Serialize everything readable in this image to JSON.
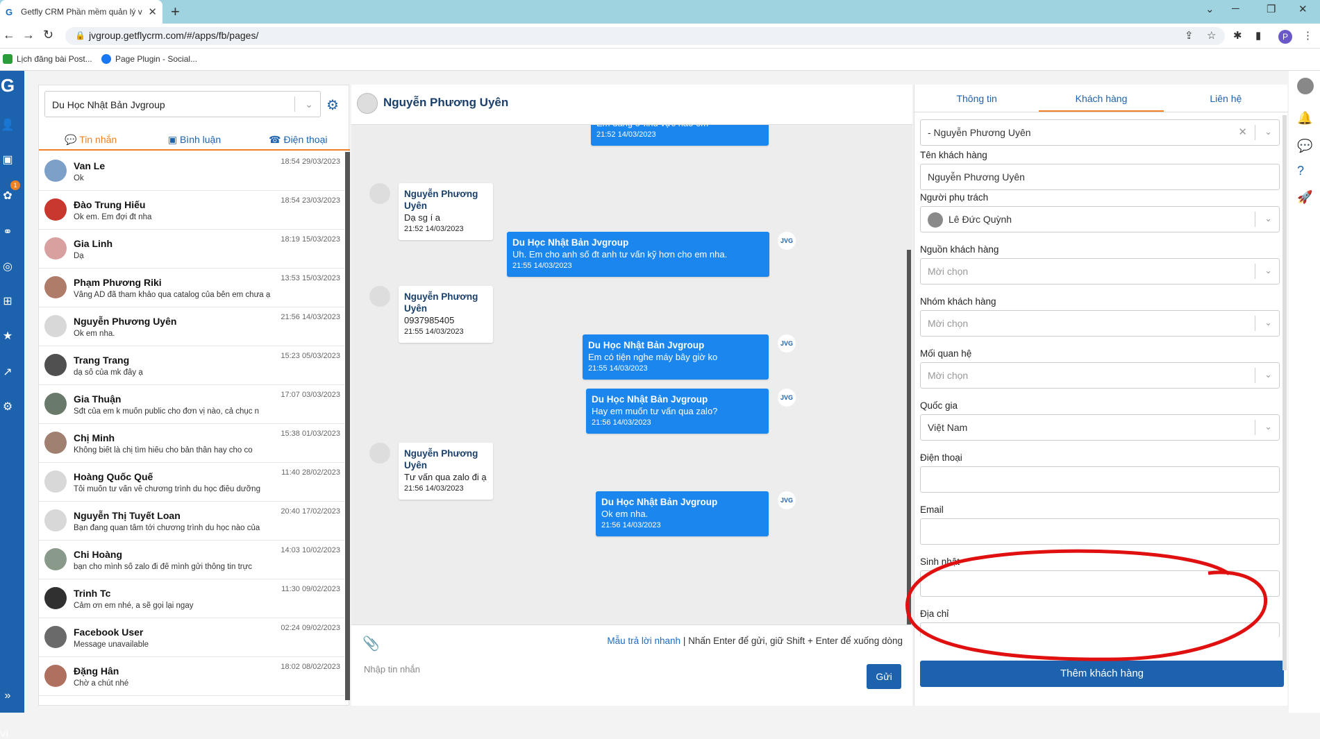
{
  "browser": {
    "tab_title": "Getfly CRM Phần mềm quản lý v",
    "url": "jvgroup.getflycrm.com/#/apps/fb/pages/",
    "bookmarks": [
      "Lịch đăng bài Post...",
      "Page Plugin - Social..."
    ],
    "profile_initial": "P"
  },
  "leftnav": {
    "badge": "1",
    "lang": "VI"
  },
  "page_select": {
    "value": "Du Học Nhật Bản Jvgroup"
  },
  "conv_tabs": [
    "Tin nhắn",
    "Bình luận",
    "Điện thoại"
  ],
  "conversations": [
    {
      "name": "Van Le",
      "preview": "Ok",
      "time": "18:54 29/03/2023"
    },
    {
      "name": "Đào Trung Hiếu",
      "preview": "Ok em. Em đợi đt nha",
      "time": "18:54 23/03/2023"
    },
    {
      "name": "Gia Linh",
      "preview": "Dạ",
      "time": "18:19 15/03/2023"
    },
    {
      "name": "Phạm Phương Riki",
      "preview": "Vâng AD đã tham khảo qua catalog của bên em chưa ạ",
      "time": "13:53 15/03/2023"
    },
    {
      "name": "Nguyễn Phương Uyên",
      "preview": "Ok em nha.",
      "time": "21:56 14/03/2023"
    },
    {
      "name": "Trang Trang",
      "preview": "dạ số của mk đây ạ",
      "time": "15:23 05/03/2023"
    },
    {
      "name": "Gia Thuận",
      "preview": "Sđt của em k muốn public cho đơn vị nào, cả chục n",
      "time": "17:07 03/03/2023"
    },
    {
      "name": "Chị Minh",
      "preview": "Không biết là chị tìm hiểu cho bản thân hay cho co",
      "time": "15:38 01/03/2023"
    },
    {
      "name": "Hoàng Quốc Quế",
      "preview": "Tôi muốn tư vấn về chương trình du học điều dưỡng",
      "time": "11:40 28/02/2023"
    },
    {
      "name": "Nguyễn Thị Tuyết Loan",
      "preview": "Bạn đang quan tâm tới chương trình du học nào của",
      "time": "20:40 17/02/2023"
    },
    {
      "name": "Chi Hoàng",
      "preview": "bạn cho mình số zalo đi để mình gửi thông tin trực",
      "time": "14:03 10/02/2023"
    },
    {
      "name": "Trinh Tc",
      "preview": "Cảm ơn em nhé, a sẽ gọi lại ngay",
      "time": "11:30 09/02/2023"
    },
    {
      "name": "Facebook User",
      "preview": "Message unavailable",
      "time": "02:24 09/02/2023"
    },
    {
      "name": "Đặng Hân",
      "preview": "Chờ a chút nhé",
      "time": "18:02 08/02/2023"
    }
  ],
  "chat": {
    "contact_name": "Nguyễn Phương Uyên",
    "messages": [
      {
        "dir": "out",
        "sender": "",
        "text": "Em đang ở khu vực nào em",
        "time": "21:52 14/03/2023"
      },
      {
        "dir": "in",
        "sender": "Nguyễn Phương Uyên",
        "text": "Dạ sg í a",
        "time": "21:52 14/03/2023"
      },
      {
        "dir": "out",
        "sender": "Du Học Nhật Bản Jvgroup",
        "text": "Uh. Em cho anh số đt anh tư vấn kỹ hơn cho em nha.",
        "time": "21:55 14/03/2023"
      },
      {
        "dir": "in",
        "sender": "Nguyễn Phương Uyên",
        "text": "0937985405",
        "time": "21:55 14/03/2023"
      },
      {
        "dir": "out",
        "sender": "Du Học Nhật Bản Jvgroup",
        "text": "Em có tiện nghe máy bây giờ ko",
        "time": "21:55 14/03/2023"
      },
      {
        "dir": "out",
        "sender": "Du Học Nhật Bản Jvgroup",
        "text": "Hay em muốn tư vấn qua zalo?",
        "time": "21:56 14/03/2023"
      },
      {
        "dir": "in",
        "sender": "Nguyễn Phương Uyên",
        "text": "Tư vấn qua zalo đi ạ",
        "time": "21:56 14/03/2023"
      },
      {
        "dir": "out",
        "sender": "Du Học Nhật Bản Jvgroup",
        "text": "Ok em nha.",
        "time": "21:56 14/03/2023"
      }
    ],
    "avatar_brand": "JVG",
    "hint_link": "Mẫu trả lời nhanh",
    "hint_text": " | Nhấn Enter để gửi, giữ Shift + Enter để xuống dòng",
    "input_placeholder": "Nhập tin nhắn",
    "send_label": "Gửi"
  },
  "info": {
    "tabs": [
      "Thông tin",
      "Khách hàng",
      "Liên hệ"
    ],
    "customer_select": "- Nguyễn Phương Uyên",
    "fields": {
      "name_label": "Tên khách hàng",
      "name_value": "Nguyễn Phương Uyên",
      "owner_label": "Người phụ trách",
      "owner_value": "Lê Đức Quỳnh",
      "source_label": "Nguồn khách hàng",
      "source_value": "Mời chọn",
      "group_label": "Nhóm khách hàng",
      "group_value": "Mời chọn",
      "relation_label": "Mối quan hệ",
      "relation_value": "Mời chọn",
      "country_label": "Quốc gia",
      "country_value": "Việt Nam",
      "phone_label": "Điện thoại",
      "email_label": "Email",
      "birthday_label": "Sinh nhật",
      "address_label": "Địa chỉ"
    },
    "add_button": "Thêm khách hàng"
  },
  "colors": {
    "brand": "#1d62ad",
    "accent": "#f08020",
    "outgoing": "#1a86ee",
    "annotation": "#e01010"
  }
}
